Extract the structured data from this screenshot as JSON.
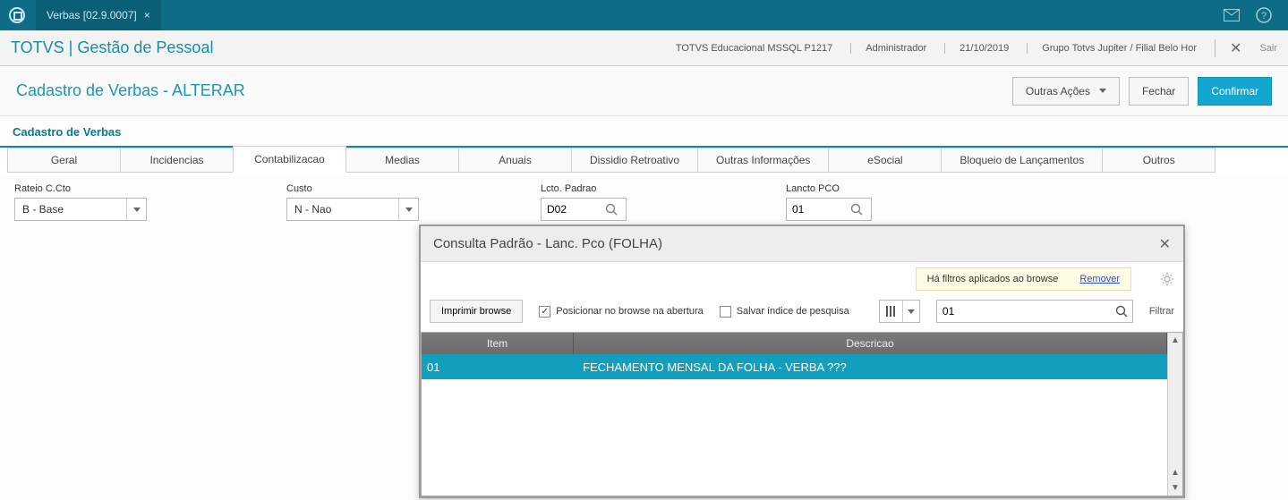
{
  "titlebar": {
    "tab_label": "Verbas [02.9.0007]"
  },
  "appheader": {
    "brand": "TOTVS | Gestão de Pessoal",
    "status_env": "TOTVS Educacional MSSQL P1217",
    "status_user": "Administrador",
    "status_date": "21/10/2019",
    "status_group": "Grupo Totvs Jupiter / Filial Belo Hor",
    "exit_label": "Sair"
  },
  "actionbar": {
    "page_title": "Cadastro de Verbas - ALTERAR",
    "other_actions": "Outras Ações",
    "close": "Fechar",
    "confirm": "Confirmar"
  },
  "section_title": "Cadastro de Verbas",
  "tabs": {
    "geral": "Geral",
    "incidencias": "Incidencias",
    "contabilizacao": "Contabilizacao",
    "medias": "Medias",
    "anuais": "Anuais",
    "dissidio": "Dissidio Retroativo",
    "outras_info": "Outras Informações",
    "esocial": "eSocial",
    "bloqueio": "Bloqueio de Lançamentos",
    "outros": "Outros"
  },
  "fields": {
    "rateio_label": "Rateio C.Cto",
    "rateio_value": "B - Base",
    "custo_label": "Custo",
    "custo_value": "N - Nao",
    "lcto_padrao_label": "Lcto. Padrao",
    "lcto_padrao_value": "D02",
    "lancto_pco_label": "Lancto PCO",
    "lancto_pco_value": "01"
  },
  "dialog": {
    "title": "Consulta Padrão - Lanc. Pco (FOLHA)",
    "filter_msg": "Há filtros aplicados ao browse",
    "remove": "Remover",
    "print": "Imprimir browse",
    "posicionar": "Posicionar no browse na abertura",
    "salvar_idx": "Salvar índice de pesquisa",
    "search_value": "01",
    "filtrar": "Filtrar",
    "col_item": "Item",
    "col_desc": "Descricao",
    "row": {
      "item": "01",
      "desc": "FECHAMENTO MENSAL DA FOLHA - VERBA ???"
    }
  }
}
